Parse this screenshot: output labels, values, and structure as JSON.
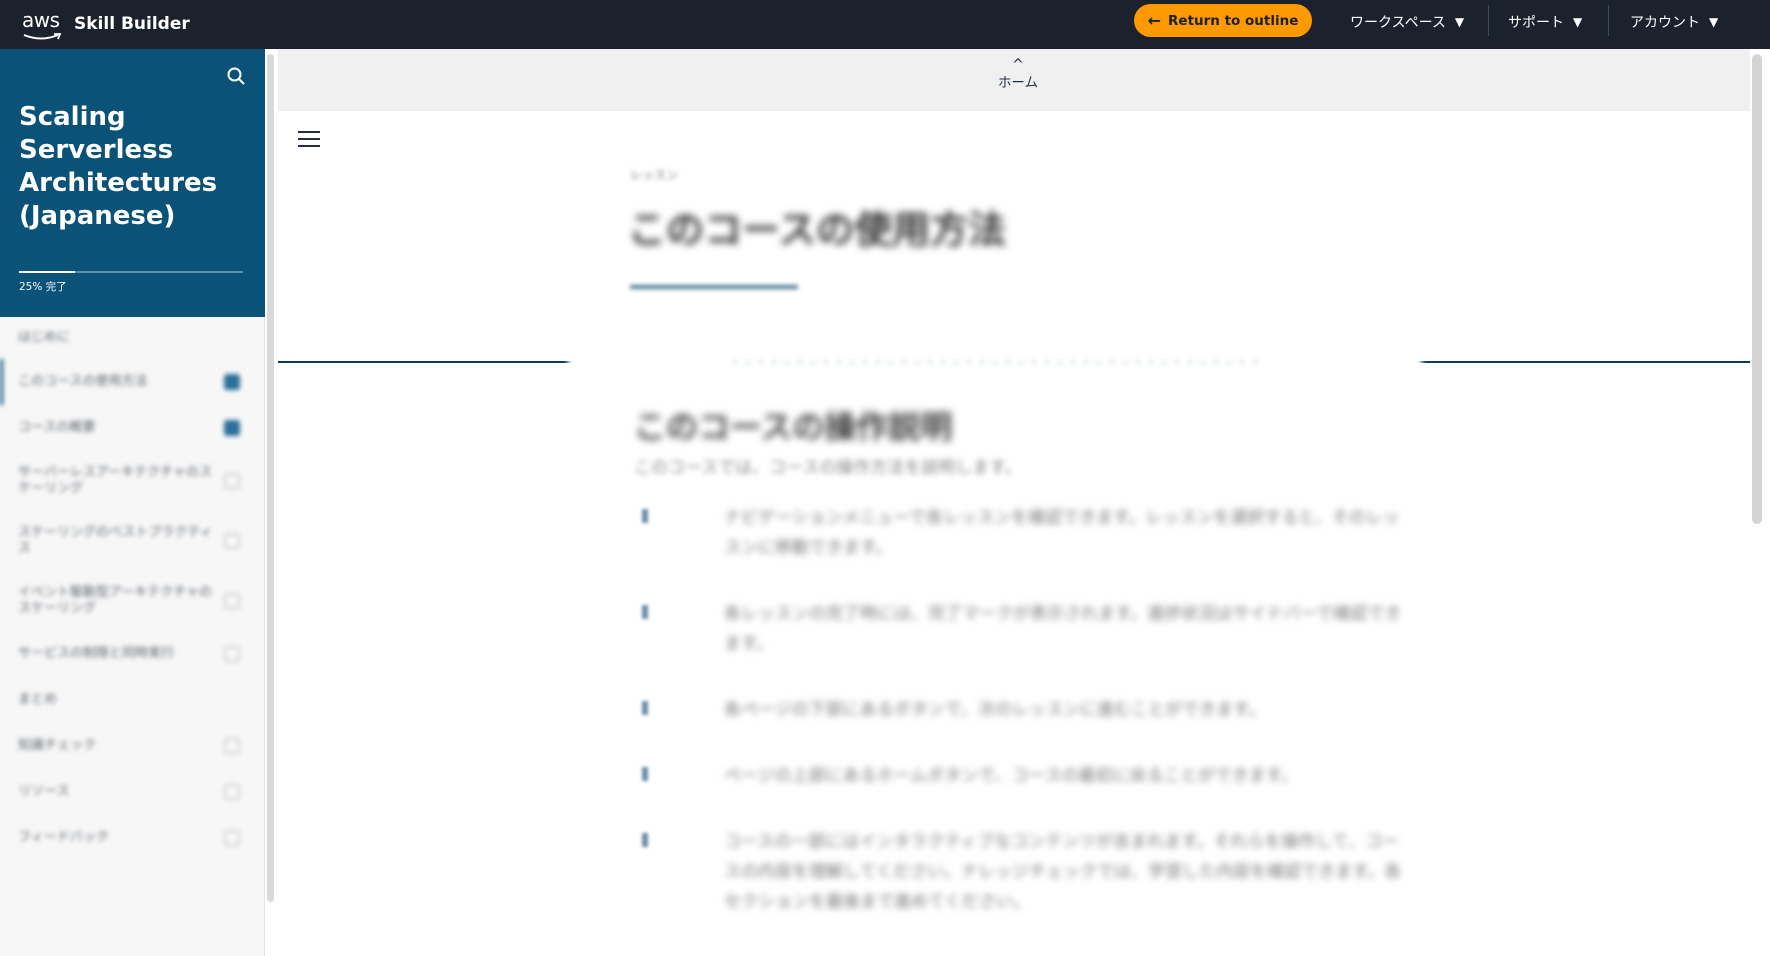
{
  "topbar": {
    "logo_text": "aws",
    "app_name": "Skill Builder",
    "return_label": "Return to outline",
    "nav": [
      {
        "label": "ワークスペース"
      },
      {
        "label": "サポート"
      },
      {
        "label": "アカウント"
      }
    ],
    "colors": {
      "bar": "#1b222d",
      "accent": "#ff9900"
    }
  },
  "sidebar": {
    "course_title": "Scaling Serverless Architectures (Japanese)",
    "progress_label": "25% 完了",
    "progress_fraction": 0.25,
    "header_color": "#0a5278",
    "items": [
      {
        "label": "はじめに",
        "status": "none"
      },
      {
        "label": "このコースの使用方法",
        "status": "done",
        "active": true
      },
      {
        "label": "コースの概要",
        "status": "done"
      },
      {
        "label": "サーバーレスアーキテクチャのスケーリング",
        "status": "open"
      },
      {
        "label": "スケーリングのベストプラクティス",
        "status": "open"
      },
      {
        "label": "イベント駆動型アーキテクチャのスケーリング",
        "status": "open"
      },
      {
        "label": "サービスの制限と同時実行",
        "status": "open"
      },
      {
        "label": "まとめ",
        "status": "none"
      },
      {
        "label": "知識チェック",
        "status": "open"
      },
      {
        "label": "リソース",
        "status": "open"
      },
      {
        "label": "フィードバック",
        "status": "open"
      }
    ]
  },
  "main": {
    "home_label": "ホーム",
    "lesson_kicker": "レッスン",
    "lesson_title": "このコースの使用方法",
    "section_rule_label": "・・・・・・・・・・・・・・・・・・・・・・・・・・・・・・・・・・・・・・・・・",
    "content_heading": "このコースの操作説明",
    "content_intro": "このコースでは、コースの操作方法を説明します。",
    "bullets": [
      "ナビゲーションメニューで各レッスンを確認できます。レッスンを選択すると、そのレッスンに移動できます。",
      "各レッスンの完了時には、完了マークが表示されます。進捗状況はサイドバーで確認できます。",
      "各ページの下部にあるボタンで、次のレッスンに進むことができます。",
      "ページの上部にあるホームボタンで、コースの最初に戻ることができます。",
      "コースの一部にはインタラクティブなコンテンツが含まれます。それらを操作して、コースの内容を理解してください。ナレッジチェックでは、学習した内容を確認できます。各セクションを最後まで進めてください。"
    ]
  }
}
